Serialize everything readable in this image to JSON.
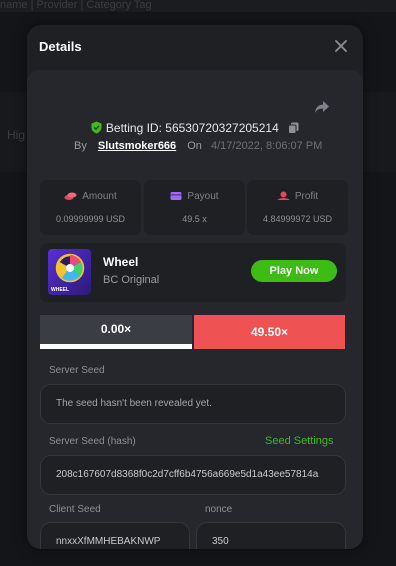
{
  "background": {
    "top_text": "name | Provider | Category Tag",
    "side_text": "Hig"
  },
  "modal": {
    "title": "Details",
    "close_icon": "close-icon"
  },
  "bet": {
    "id_label": "Betting ID:",
    "id_value": "56530720327205214",
    "by_label": "By",
    "username": "Slutsmoker666",
    "on_label": "On",
    "datetime": "4/17/2022, 8:06:07 PM"
  },
  "stats": {
    "amount": {
      "label": "Amount",
      "value": "0.09999999 USD",
      "icon": "coins-icon"
    },
    "payout": {
      "label": "Payout",
      "value": "49.5 x",
      "icon": "card-icon"
    },
    "profit": {
      "label": "Profit",
      "value": "4.84999972 USD",
      "icon": "profit-icon"
    }
  },
  "game": {
    "name": "Wheel",
    "subtitle": "BC Original",
    "thumb_label": "WHEEL",
    "play_label": "Play Now"
  },
  "result_tabs": {
    "left": "0.00×",
    "right": "49.50×"
  },
  "seeds": {
    "server_seed_label": "Server Seed",
    "server_seed_value": "The seed hasn't been revealed yet.",
    "server_hash_label": "Server Seed (hash)",
    "seed_settings_label": "Seed Settings",
    "server_hash_value": "208c167607d8368f0c2d7cff6b4756a669e5d1a43ee57814a",
    "client_seed_label": "Client Seed",
    "client_seed_value": "nnxxXfMMHEBAKNWP",
    "nonce_label": "nonce",
    "nonce_value": "350"
  },
  "colors": {
    "accent_green": "#3cbc14",
    "result_red": "#ee5252",
    "shield_green": "#3cbc14"
  }
}
